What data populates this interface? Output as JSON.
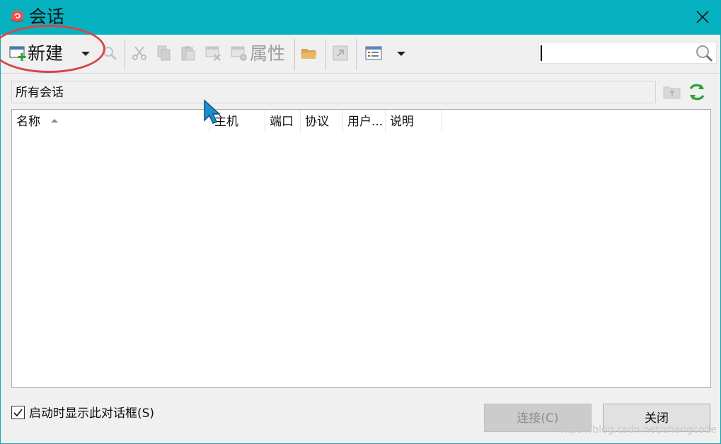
{
  "window": {
    "title": "会话"
  },
  "toolbar": {
    "new_label": "新建",
    "properties_label": "属性",
    "search": {
      "value": "",
      "placeholder": ""
    }
  },
  "path_bar": {
    "text": "所有会话"
  },
  "session_list": {
    "columns": [
      "名称",
      "主机",
      "端口",
      "协议",
      "用户...",
      "说明"
    ],
    "sorted_column": "名称",
    "sort_direction": "ascending",
    "rows": []
  },
  "footer": {
    "startup_checkbox_label": "启动时显示此对话框(S)",
    "startup_checkbox_checked": true,
    "connect_label": "连接(C)",
    "close_label": "关闭"
  },
  "watermark": "https://blog.csdn.net/shangcode",
  "colors": {
    "titlebar": "#06b2bf",
    "annotation_ellipse": "#d9434c",
    "refresh_green": "#2fa33b"
  }
}
